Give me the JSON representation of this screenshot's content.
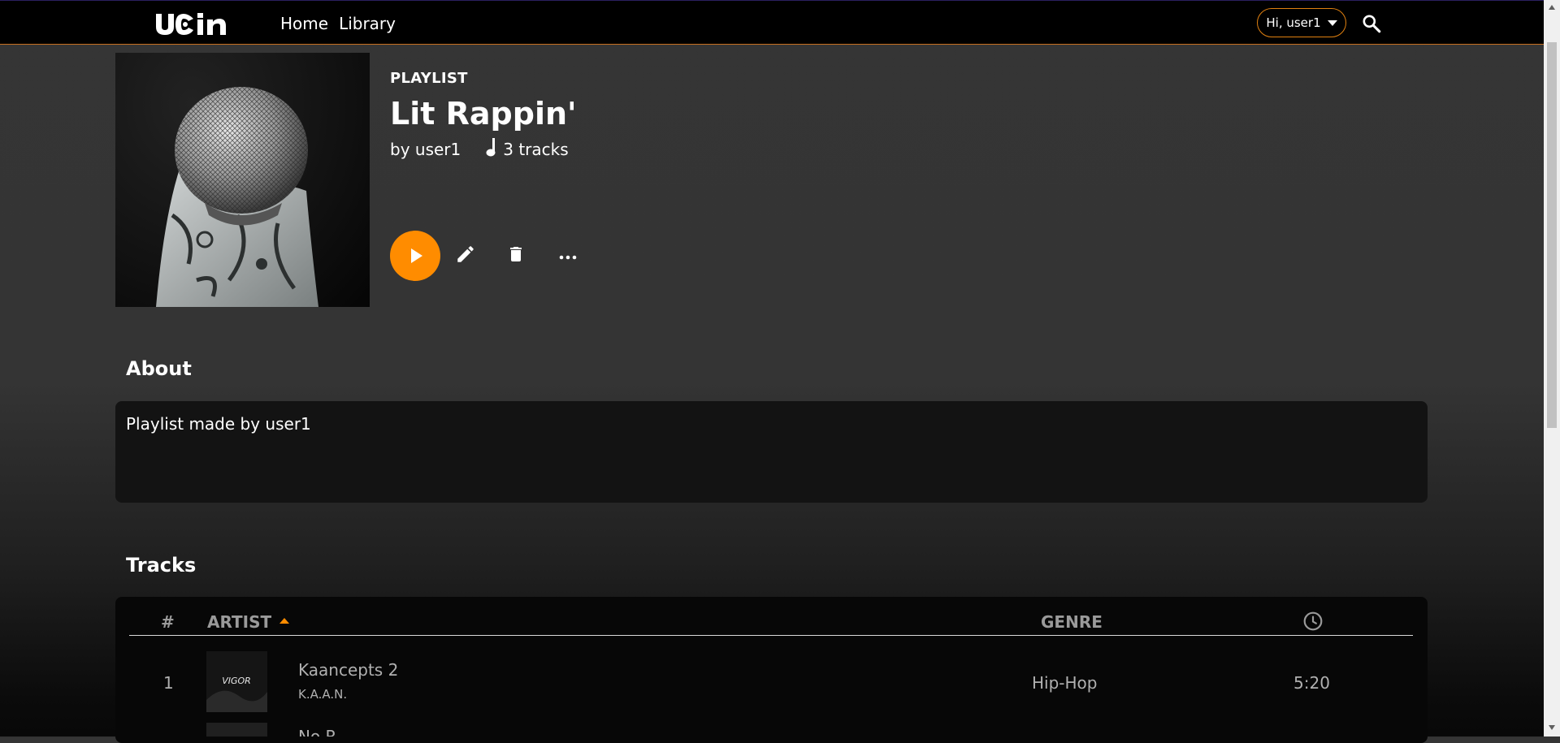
{
  "nav": {
    "home": "Home",
    "library": "Library",
    "user_greeting": "Hi, user1"
  },
  "icons": {
    "logo": "logo",
    "search": "search-icon",
    "caret": "chevron-down-icon",
    "note": "music-note-icon",
    "play": "play-icon",
    "edit": "pencil-icon",
    "delete": "trash-icon",
    "more": "more-horizontal-icon",
    "duration": "clock-icon"
  },
  "colors": {
    "accent": "#ff8c00",
    "background": "#353535",
    "panel": "#131313"
  },
  "playlist": {
    "kind": "PLAYLIST",
    "title": "Lit Rappin'",
    "owner": "by user1",
    "track_count": "3 tracks"
  },
  "about": {
    "heading": "About",
    "text": "Playlist made by user1"
  },
  "tracks": {
    "heading": "Tracks",
    "columns": {
      "index": "#",
      "artist": "ARTIST",
      "genre": "GENRE"
    },
    "rows": [
      {
        "index": "1",
        "title": "Kaancepts 2",
        "artist": "K.A.A.N.",
        "genre": "Hip-Hop",
        "duration": "5:20",
        "thumb_text": "VIGOR"
      },
      {
        "index": "",
        "title": "No R",
        "artist": "",
        "genre": "",
        "duration": "",
        "thumb_text": ""
      }
    ]
  }
}
